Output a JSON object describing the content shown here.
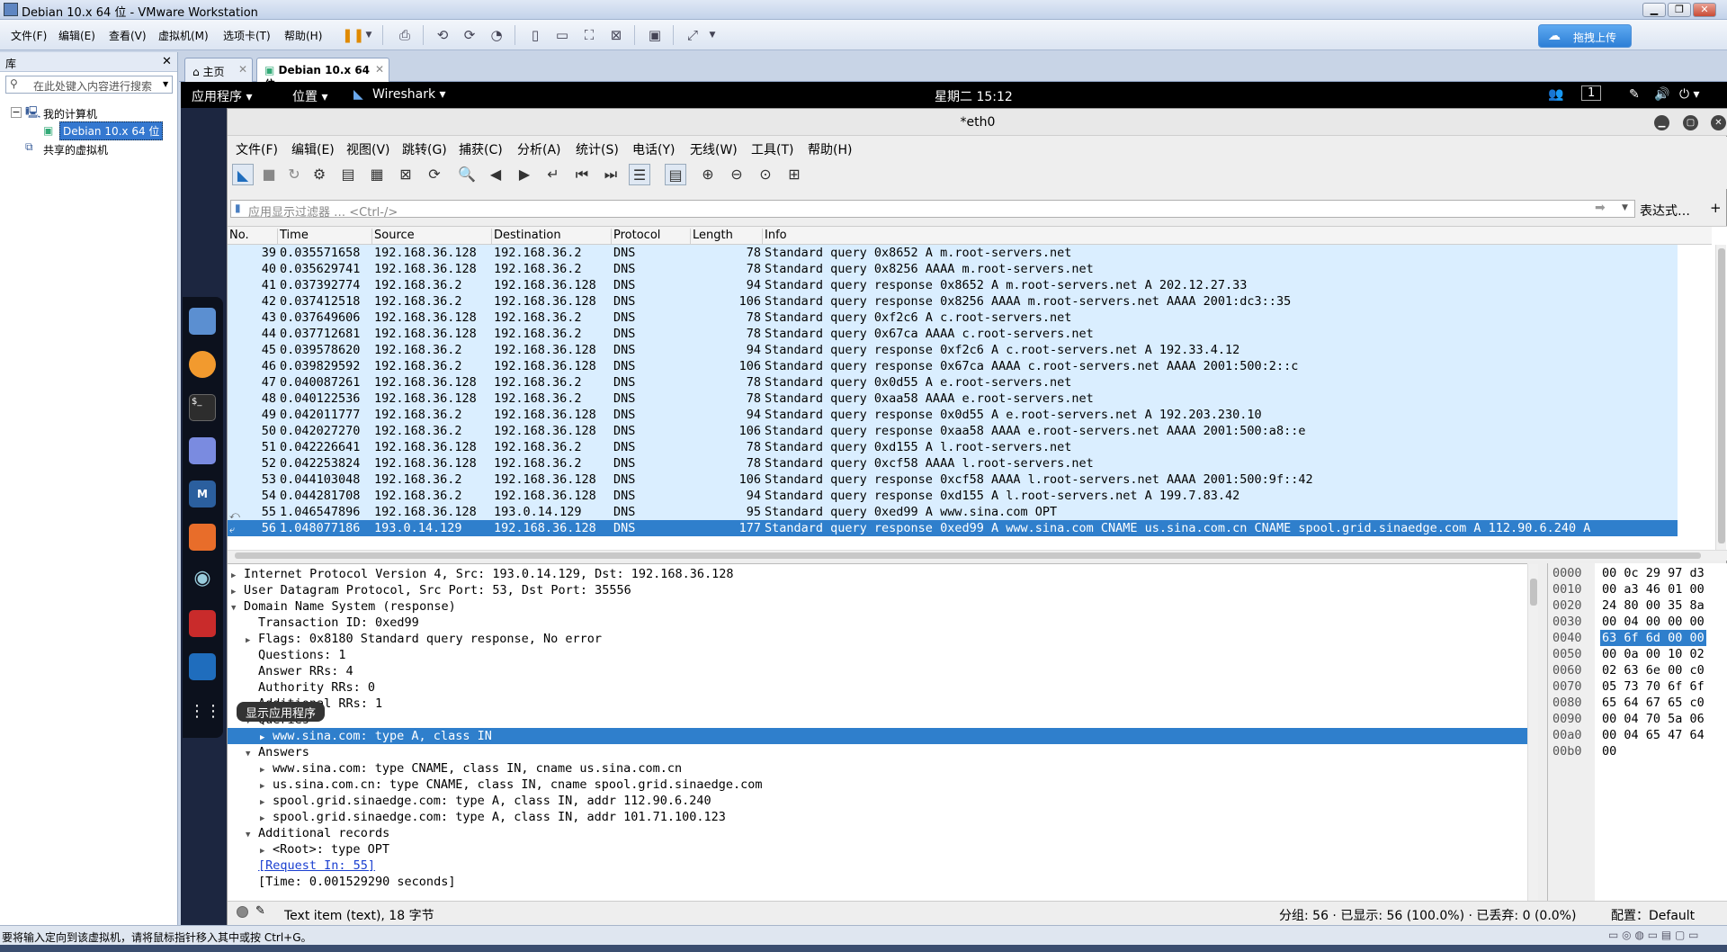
{
  "vmware": {
    "title": "Debian 10.x 64 位 - VMware Workstation",
    "menu": [
      "文件(F)",
      "编辑(E)",
      "查看(V)",
      "虚拟机(M)",
      "选项卡(T)",
      "帮助(H)"
    ],
    "upload_label": "拖拽上传",
    "library": {
      "title": "库",
      "search_placeholder": "在此处键入内容进行搜索",
      "tree": [
        "我的计算机",
        "Debian 10.x 64 位",
        "共享的虚拟机"
      ]
    },
    "tabs": [
      "主页",
      "Debian 10.x 64 位"
    ],
    "status_text": "要将输入定向到该虚拟机，请将鼠标指针移入其中或按 Ctrl+G。"
  },
  "gnome": {
    "apps": "应用程序",
    "places": "位置",
    "wireshark": "Wireshark",
    "clock": "星期二 15:12",
    "workspace": "1",
    "dock_tooltip": "显示应用程序"
  },
  "wireshark": {
    "title": "*eth0",
    "menu": [
      "文件(F)",
      "编辑(E)",
      "视图(V)",
      "跳转(G)",
      "捕获(C)",
      "分析(A)",
      "统计(S)",
      "电话(Y)",
      "无线(W)",
      "工具(T)",
      "帮助(H)"
    ],
    "filter_placeholder": "应用显示过滤器 … <Ctrl-/>",
    "expression_label": "表达式…",
    "plus_label": "+",
    "columns": [
      "No.",
      "Time",
      "Source",
      "Destination",
      "Protocol",
      "Length",
      "Info"
    ],
    "packets": [
      {
        "no": "39",
        "time": "0.035571658",
        "src": "192.168.36.128",
        "dst": "192.168.36.2",
        "proto": "DNS",
        "len": "78",
        "info": "Standard query 0x8652 A m.root-servers.net"
      },
      {
        "no": "40",
        "time": "0.035629741",
        "src": "192.168.36.128",
        "dst": "192.168.36.2",
        "proto": "DNS",
        "len": "78",
        "info": "Standard query 0x8256 AAAA m.root-servers.net"
      },
      {
        "no": "41",
        "time": "0.037392774",
        "src": "192.168.36.2",
        "dst": "192.168.36.128",
        "proto": "DNS",
        "len": "94",
        "info": "Standard query response 0x8652 A m.root-servers.net A 202.12.27.33"
      },
      {
        "no": "42",
        "time": "0.037412518",
        "src": "192.168.36.2",
        "dst": "192.168.36.128",
        "proto": "DNS",
        "len": "106",
        "info": "Standard query response 0x8256 AAAA m.root-servers.net AAAA 2001:dc3::35"
      },
      {
        "no": "43",
        "time": "0.037649606",
        "src": "192.168.36.128",
        "dst": "192.168.36.2",
        "proto": "DNS",
        "len": "78",
        "info": "Standard query 0xf2c6 A c.root-servers.net"
      },
      {
        "no": "44",
        "time": "0.037712681",
        "src": "192.168.36.128",
        "dst": "192.168.36.2",
        "proto": "DNS",
        "len": "78",
        "info": "Standard query 0x67ca AAAA c.root-servers.net"
      },
      {
        "no": "45",
        "time": "0.039578620",
        "src": "192.168.36.2",
        "dst": "192.168.36.128",
        "proto": "DNS",
        "len": "94",
        "info": "Standard query response 0xf2c6 A c.root-servers.net A 192.33.4.12"
      },
      {
        "no": "46",
        "time": "0.039829592",
        "src": "192.168.36.2",
        "dst": "192.168.36.128",
        "proto": "DNS",
        "len": "106",
        "info": "Standard query response 0x67ca AAAA c.root-servers.net AAAA 2001:500:2::c"
      },
      {
        "no": "47",
        "time": "0.040087261",
        "src": "192.168.36.128",
        "dst": "192.168.36.2",
        "proto": "DNS",
        "len": "78",
        "info": "Standard query 0x0d55 A e.root-servers.net"
      },
      {
        "no": "48",
        "time": "0.040122536",
        "src": "192.168.36.128",
        "dst": "192.168.36.2",
        "proto": "DNS",
        "len": "78",
        "info": "Standard query 0xaa58 AAAA e.root-servers.net"
      },
      {
        "no": "49",
        "time": "0.042011777",
        "src": "192.168.36.2",
        "dst": "192.168.36.128",
        "proto": "DNS",
        "len": "94",
        "info": "Standard query response 0x0d55 A e.root-servers.net A 192.203.230.10"
      },
      {
        "no": "50",
        "time": "0.042027270",
        "src": "192.168.36.2",
        "dst": "192.168.36.128",
        "proto": "DNS",
        "len": "106",
        "info": "Standard query response 0xaa58 AAAA e.root-servers.net AAAA 2001:500:a8::e"
      },
      {
        "no": "51",
        "time": "0.042226641",
        "src": "192.168.36.128",
        "dst": "192.168.36.2",
        "proto": "DNS",
        "len": "78",
        "info": "Standard query 0xd155 A l.root-servers.net"
      },
      {
        "no": "52",
        "time": "0.042253824",
        "src": "192.168.36.128",
        "dst": "192.168.36.2",
        "proto": "DNS",
        "len": "78",
        "info": "Standard query 0xcf58 AAAA l.root-servers.net"
      },
      {
        "no": "53",
        "time": "0.044103048",
        "src": "192.168.36.2",
        "dst": "192.168.36.128",
        "proto": "DNS",
        "len": "106",
        "info": "Standard query response 0xcf58 AAAA l.root-servers.net AAAA 2001:500:9f::42"
      },
      {
        "no": "54",
        "time": "0.044281708",
        "src": "192.168.36.2",
        "dst": "192.168.36.128",
        "proto": "DNS",
        "len": "94",
        "info": "Standard query response 0xd155 A l.root-servers.net A 199.7.83.42"
      },
      {
        "no": "55",
        "time": "1.046547896",
        "src": "192.168.36.128",
        "dst": "193.0.14.129",
        "proto": "DNS",
        "len": "95",
        "info": "Standard query 0xed99 A www.sina.com OPT"
      },
      {
        "no": "56",
        "time": "1.048077186",
        "src": "193.0.14.129",
        "dst": "192.168.36.128",
        "proto": "DNS",
        "len": "177",
        "info": "Standard query response 0xed99 A www.sina.com CNAME us.sina.com.cn CNAME spool.grid.sinaedge.com A 112.90.6.240 A"
      }
    ],
    "details": [
      {
        "level": 0,
        "arrow": "right",
        "text": "Internet Protocol Version 4, Src: 193.0.14.129, Dst: 192.168.36.128"
      },
      {
        "level": 0,
        "arrow": "right",
        "text": "User Datagram Protocol, Src Port: 53, Dst Port: 35556"
      },
      {
        "level": 0,
        "arrow": "down",
        "text": "Domain Name System (response)"
      },
      {
        "level": 1,
        "arrow": "",
        "text": "Transaction ID: 0xed99"
      },
      {
        "level": 1,
        "arrow": "right",
        "text": "Flags: 0x8180 Standard query response, No error"
      },
      {
        "level": 1,
        "arrow": "",
        "text": "Questions: 1"
      },
      {
        "level": 1,
        "arrow": "",
        "text": "Answer RRs: 4"
      },
      {
        "level": 1,
        "arrow": "",
        "text": "Authority RRs: 0"
      },
      {
        "level": 1,
        "arrow": "",
        "text": "Additional RRs: 1"
      },
      {
        "level": 1,
        "arrow": "down",
        "text": "Queries"
      },
      {
        "level": 2,
        "arrow": "right",
        "text": "www.sina.com: type A, class IN"
      },
      {
        "level": 1,
        "arrow": "down",
        "text": "Answers"
      },
      {
        "level": 2,
        "arrow": "right",
        "text": "www.sina.com: type CNAME, class IN, cname us.sina.com.cn"
      },
      {
        "level": 2,
        "arrow": "right",
        "text": "us.sina.com.cn: type CNAME, class IN, cname spool.grid.sinaedge.com"
      },
      {
        "level": 2,
        "arrow": "right",
        "text": "spool.grid.sinaedge.com: type A, class IN, addr 112.90.6.240"
      },
      {
        "level": 2,
        "arrow": "right",
        "text": "spool.grid.sinaedge.com: type A, class IN, addr 101.71.100.123"
      },
      {
        "level": 1,
        "arrow": "down",
        "text": "Additional records"
      },
      {
        "level": 2,
        "arrow": "right",
        "text": "<Root>: type OPT"
      },
      {
        "level": 1,
        "arrow": "",
        "text": "[Request In: 55]"
      },
      {
        "level": 1,
        "arrow": "",
        "text": "[Time: 0.001529290 seconds]"
      }
    ],
    "bytes": [
      {
        "off": "0000",
        "hex": "00 0c 29 97 d3"
      },
      {
        "off": "0010",
        "hex": "00 a3 46 01 00"
      },
      {
        "off": "0020",
        "hex": "24 80 00 35 8a"
      },
      {
        "off": "0030",
        "hex": "00 04 00 00 00"
      },
      {
        "off": "0040",
        "hex": "63 6f 6d 00 00"
      },
      {
        "off": "0050",
        "hex": "00 0a 00 10 02"
      },
      {
        "off": "0060",
        "hex": "02 63 6e 00 c0"
      },
      {
        "off": "0070",
        "hex": "05 73 70 6f 6f"
      },
      {
        "off": "0080",
        "hex": "65 64 67 65 c0"
      },
      {
        "off": "0090",
        "hex": "00 04 70 5a 06"
      },
      {
        "off": "00a0",
        "hex": "00 04 65 47 64"
      },
      {
        "off": "00b0",
        "hex": "00"
      }
    ],
    "status": {
      "item": "Text item (text), 18 字节",
      "counts": "分组: 56 · 已显示: 56 (100.0%) · 已丢弃: 0 (0.0%)",
      "profile": "配置：Default"
    }
  },
  "colors": {
    "selection": "#2f7fcc",
    "dns_row": "#daeeff"
  }
}
